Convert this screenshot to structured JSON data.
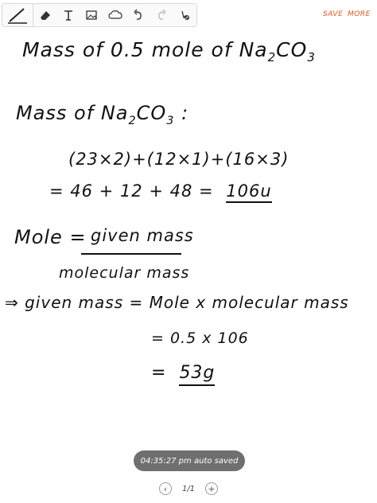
{
  "toolbar": {
    "tools": [
      {
        "name": "pen-icon"
      },
      {
        "name": "eraser-icon"
      },
      {
        "name": "text-icon"
      },
      {
        "name": "image-icon"
      },
      {
        "name": "shape-icon"
      },
      {
        "name": "undo-icon"
      },
      {
        "name": "redo-icon"
      },
      {
        "name": "touch-pen-icon"
      }
    ],
    "save_label": "SAVE",
    "more_label": "MORE",
    "accent_color": "#e2551f"
  },
  "note": {
    "line1_prefix": "Mass of 0.5 mole of Na",
    "line1_sub1": "2",
    "line1_mid": "CO",
    "line1_sub2": "3",
    "line2_prefix": "Mass of Na",
    "line2_sub1": "2",
    "line2_mid": "CO",
    "line2_sub2": "3",
    "line2_suffix": " :",
    "line3": "(23×2)+(12×1)+(16×3)",
    "line4_expr": "= 46 + 12 + 48 =",
    "line4_result": "106u",
    "mole_label": "Mole =",
    "mole_numerator": "given mass",
    "mole_denominator": "molecular mass",
    "implies_line": "⇒  given mass = Mole x molecular mass",
    "calc_line": "= 0.5 x 106",
    "final_result_prefix": "=",
    "final_result": "53g"
  },
  "status": {
    "autosave_text": "04:35:27 pm auto saved"
  },
  "pager": {
    "prev": "‹",
    "count": "1/1",
    "add": "+"
  }
}
